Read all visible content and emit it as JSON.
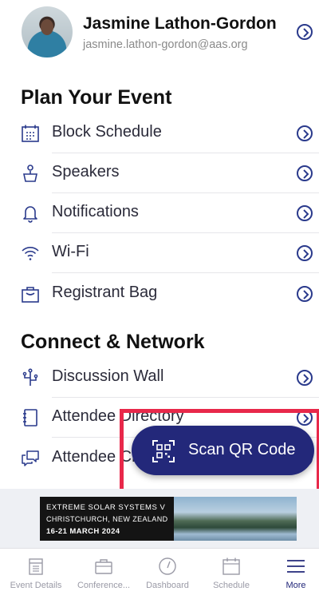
{
  "profile": {
    "name": "Jasmine Lathon-Gordon",
    "email": "jasmine.lathon-gordon@aas.org"
  },
  "plan": {
    "title": "Plan Your Event",
    "items": [
      {
        "label": "Block Schedule",
        "icon": "calendar-grid-icon"
      },
      {
        "label": "Speakers",
        "icon": "speaker-podium-icon"
      },
      {
        "label": "Notifications",
        "icon": "bell-icon"
      },
      {
        "label": "Wi-Fi",
        "icon": "wifi-icon"
      },
      {
        "label": "Registrant Bag",
        "icon": "shopping-bag-icon"
      }
    ]
  },
  "connect": {
    "title": "Connect & Network",
    "items": [
      {
        "label": "Discussion Wall",
        "icon": "flow-icon"
      },
      {
        "label": "Attendee Directory",
        "icon": "address-book-icon"
      },
      {
        "label": "Attendee Chat",
        "icon": "chat-icon"
      }
    ]
  },
  "scan_button": {
    "label": "Scan QR Code",
    "icon": "qr-code-icon"
  },
  "banner": {
    "line1": "EXTREME SOLAR SYSTEMS V",
    "line2": "CHRISTCHURCH, NEW ZEALAND",
    "line3": "16-21 MARCH 2024"
  },
  "tabs": [
    {
      "label": "Event Details",
      "icon": "document-icon"
    },
    {
      "label": "Conference...",
      "icon": "briefcase-icon"
    },
    {
      "label": "Dashboard",
      "icon": "gauge-icon"
    },
    {
      "label": "Schedule",
      "icon": "calendar-icon"
    },
    {
      "label": "More",
      "icon": "menu-icon",
      "active": true
    }
  ],
  "colors": {
    "accent": "#23287a",
    "highlight": "#e8284a",
    "muted": "#9a9aa6"
  }
}
